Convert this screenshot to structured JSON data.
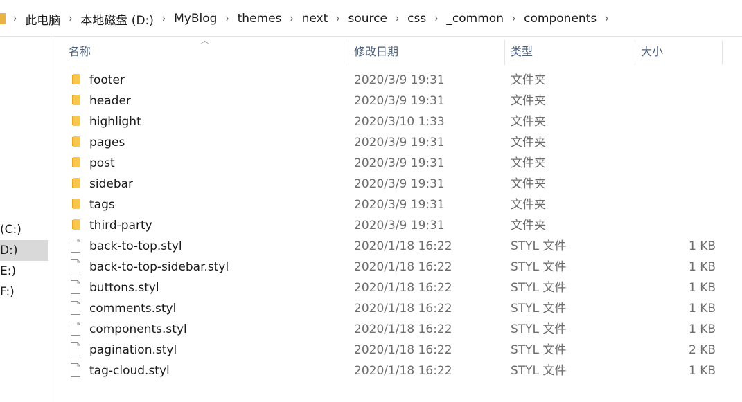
{
  "breadcrumb": [
    "此电脑",
    "本地磁盘 (D:)",
    "MyBlog",
    "themes",
    "next",
    "source",
    "css",
    "_common",
    "components"
  ],
  "nav_items": [
    {
      "label": "(C:)",
      "selected": false
    },
    {
      "label": "D:)",
      "selected": true
    },
    {
      "label": "E:)",
      "selected": false
    },
    {
      "label": "F:)",
      "selected": false
    }
  ],
  "columns": {
    "name": "名称",
    "date": "修改日期",
    "type": "类型",
    "size": "大小"
  },
  "files": [
    {
      "name": "footer",
      "date": "2020/3/9 19:31",
      "type": "文件夹",
      "size": "",
      "kind": "folder"
    },
    {
      "name": "header",
      "date": "2020/3/9 19:31",
      "type": "文件夹",
      "size": "",
      "kind": "folder"
    },
    {
      "name": "highlight",
      "date": "2020/3/10 1:33",
      "type": "文件夹",
      "size": "",
      "kind": "folder"
    },
    {
      "name": "pages",
      "date": "2020/3/9 19:31",
      "type": "文件夹",
      "size": "",
      "kind": "folder"
    },
    {
      "name": "post",
      "date": "2020/3/9 19:31",
      "type": "文件夹",
      "size": "",
      "kind": "folder"
    },
    {
      "name": "sidebar",
      "date": "2020/3/9 19:31",
      "type": "文件夹",
      "size": "",
      "kind": "folder"
    },
    {
      "name": "tags",
      "date": "2020/3/9 19:31",
      "type": "文件夹",
      "size": "",
      "kind": "folder"
    },
    {
      "name": "third-party",
      "date": "2020/3/9 19:31",
      "type": "文件夹",
      "size": "",
      "kind": "folder"
    },
    {
      "name": "back-to-top.styl",
      "date": "2020/1/18 16:22",
      "type": "STYL 文件",
      "size": "1 KB",
      "kind": "file"
    },
    {
      "name": "back-to-top-sidebar.styl",
      "date": "2020/1/18 16:22",
      "type": "STYL 文件",
      "size": "1 KB",
      "kind": "file"
    },
    {
      "name": "buttons.styl",
      "date": "2020/1/18 16:22",
      "type": "STYL 文件",
      "size": "1 KB",
      "kind": "file"
    },
    {
      "name": "comments.styl",
      "date": "2020/1/18 16:22",
      "type": "STYL 文件",
      "size": "1 KB",
      "kind": "file"
    },
    {
      "name": "components.styl",
      "date": "2020/1/18 16:22",
      "type": "STYL 文件",
      "size": "1 KB",
      "kind": "file"
    },
    {
      "name": "pagination.styl",
      "date": "2020/1/18 16:22",
      "type": "STYL 文件",
      "size": "2 KB",
      "kind": "file"
    },
    {
      "name": "tag-cloud.styl",
      "date": "2020/1/18 16:22",
      "type": "STYL 文件",
      "size": "1 KB",
      "kind": "file"
    }
  ],
  "colors": {
    "folder": "#f8c64a",
    "folder_dark": "#e8a820",
    "header_text": "#4c607a",
    "selected_nav": "#d9d9d9"
  }
}
